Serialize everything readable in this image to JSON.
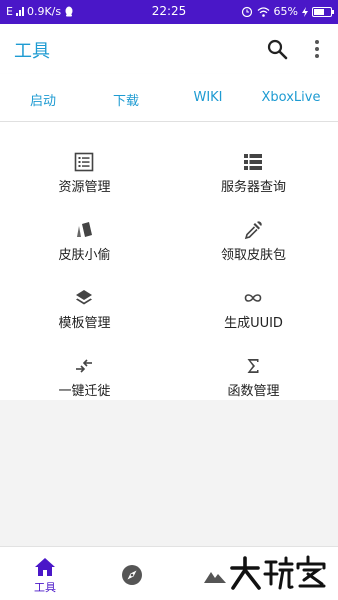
{
  "status_bar": {
    "signal": "E",
    "speed": "0.9K/s",
    "time": "22:25",
    "battery": "65%",
    "battery_level": 0.65
  },
  "app_bar": {
    "title": "工具",
    "search_icon": "search-icon",
    "more_icon": "more-vert-icon"
  },
  "tabs": [
    {
      "label": "启动"
    },
    {
      "label": "下载"
    },
    {
      "label": "WIKI"
    },
    {
      "label": "XboxLive"
    }
  ],
  "tools": [
    {
      "label": "资源管理",
      "icon": "list-box-icon"
    },
    {
      "label": "服务器查询",
      "icon": "server-list-icon"
    },
    {
      "label": "皮肤小偷",
      "icon": "skin-icon"
    },
    {
      "label": "领取皮肤包",
      "icon": "eyedropper-icon"
    },
    {
      "label": "模板管理",
      "icon": "layers-icon"
    },
    {
      "label": "生成UUID",
      "icon": "infinity-icon"
    },
    {
      "label": "一键迁徙",
      "icon": "transfer-arrows-icon"
    },
    {
      "label": "函数管理",
      "icon": "sigma-icon"
    }
  ],
  "bottom_nav": [
    {
      "label": "工具",
      "icon": "home-icon"
    },
    {
      "label": "",
      "icon": "compass-icon"
    },
    {
      "label": "",
      "icon": "mountain-icon"
    }
  ],
  "watermark": "大玩家",
  "colors": {
    "status_bar": "#4a17c8",
    "accent": "#1e9bd2",
    "nav_active": "#4a17c8",
    "icon": "#444444"
  }
}
